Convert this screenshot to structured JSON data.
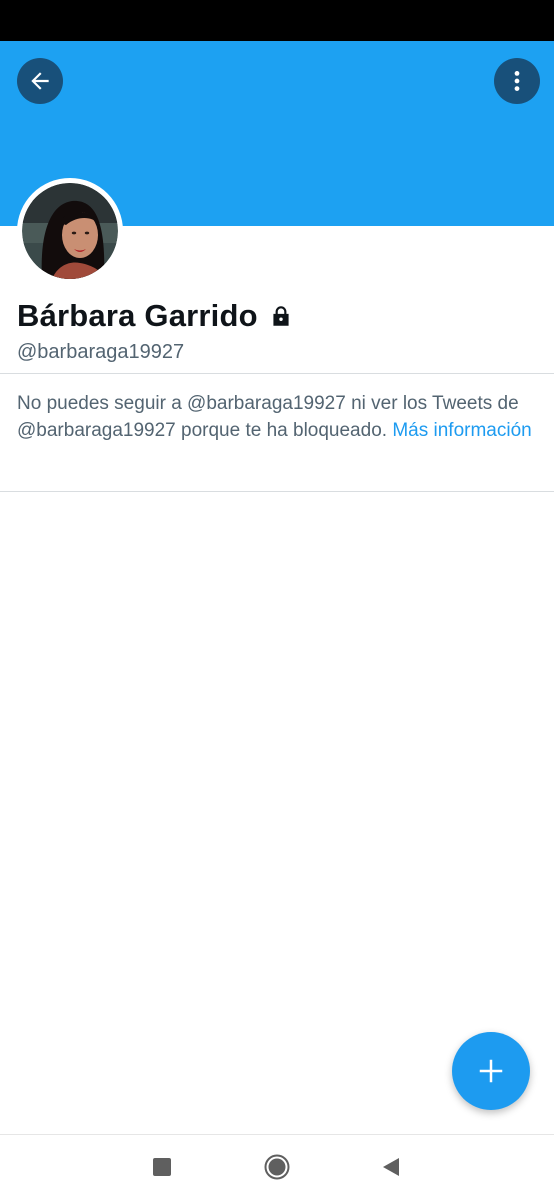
{
  "profile": {
    "display_name": "Bárbara Garrido",
    "handle": "@barbaraga19927",
    "protected": true
  },
  "blocked_notice": {
    "text": "No puedes seguir a @barbaraga19927 ni ver los Tweets de @barbaraga19927 porque te ha bloqueado.",
    "link_label": "Más información"
  },
  "icons": {
    "back": "arrow-left-icon",
    "more": "more-vertical-icon",
    "lock": "lock-icon",
    "compose": "plus-icon",
    "nav_recents": "square-icon",
    "nav_home": "circle-icon",
    "nav_back": "triangle-back-icon"
  },
  "colors": {
    "banner": "#1da1f2",
    "accent": "#1d9bf0",
    "text_primary": "#0f1419",
    "text_secondary": "#536471"
  }
}
